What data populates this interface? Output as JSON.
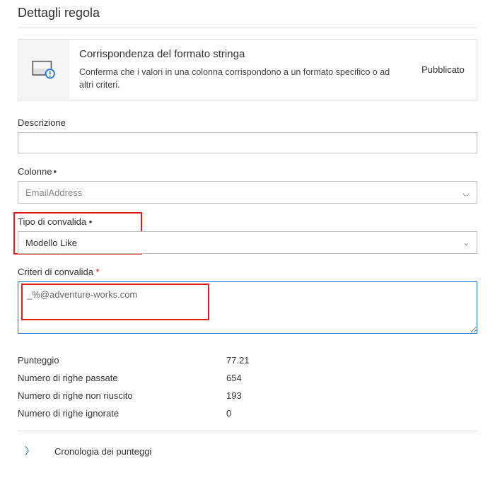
{
  "page_title": "Dettagli regola",
  "rule": {
    "title": "Corrispondenza del formato stringa",
    "description": "Conferma che i valori in una colonna corrispondono a un formato specifico o ad altri criteri.",
    "status": "Pubblicato"
  },
  "fields": {
    "description_label": "Descrizione",
    "description_value": "",
    "columns_label": "Colonne",
    "columns_value": "EmailAddress",
    "validation_type_label": "Tipo di convalida",
    "validation_type_value": "Modello Like",
    "validation_criteria_label": "Criteri di convalida",
    "validation_criteria_value": "_%@adventure-works.com"
  },
  "stats": {
    "score_label": "Punteggio",
    "score_value": "77.21",
    "passed_label": "Numero di righe passate",
    "passed_value": "654",
    "failed_label": "Numero di righe non riuscito",
    "failed_value": "193",
    "ignored_label": "Numero di righe ignorate",
    "ignored_value": "0"
  },
  "history_label": "Cronologia dei punteggi"
}
